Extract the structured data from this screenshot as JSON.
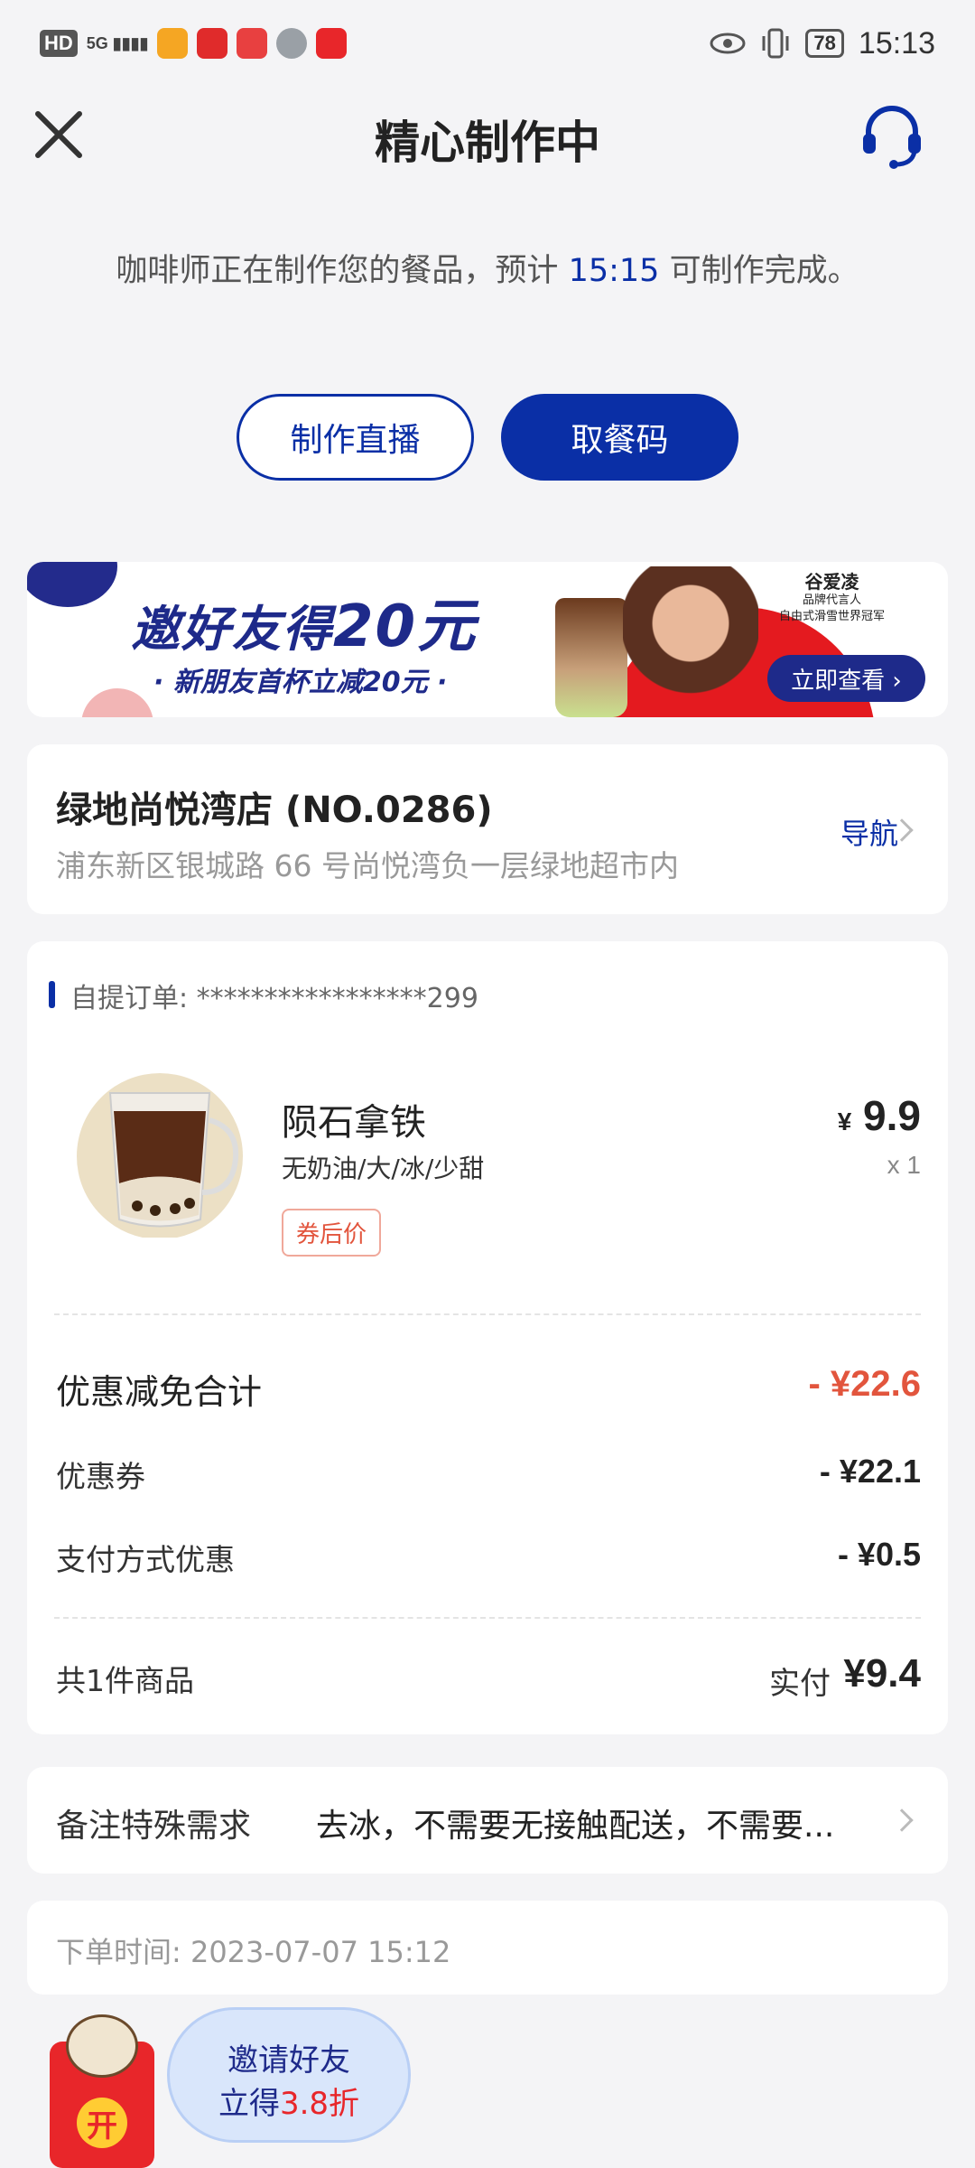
{
  "status_bar": {
    "hd": "HD",
    "signal": "5G",
    "battery": "78",
    "time": "15:13"
  },
  "nav": {
    "title": "精心制作中"
  },
  "progress": {
    "text_before": "咖啡师正在制作您的餐品，预计 ",
    "eta": "15:15",
    "text_after": " 可制作完成。"
  },
  "actions": {
    "live_label": "制作直播",
    "pickup_code_label": "取餐码"
  },
  "banner": {
    "title_prefix": "邀好友得",
    "title_amount": "20元",
    "subtitle": "· 新朋友首杯立减20元 ·",
    "brand_name": "谷爱凌",
    "brand_line1": "品牌代言人",
    "brand_line2": "自由式滑雪世界冠军",
    "cta": "立即查看 ›"
  },
  "store": {
    "name": "绿地尚悦湾店 (NO.0286)",
    "address": "浦东新区银城路 66 号尚悦湾负一层绿地超市内",
    "nav_label": "导航"
  },
  "order": {
    "id_label": "自提订单: *****************299",
    "product": {
      "name": "陨石拿铁",
      "spec": "无奶油/大/冰/少甜",
      "tag": "券后价",
      "price_symbol": "¥",
      "price": "9.9",
      "qty": "x 1"
    },
    "discount_total_label": "优惠减免合计",
    "discount_total_value": "- ¥22.6",
    "coupon_label": "优惠券",
    "coupon_value": "- ¥22.1",
    "payment_discount_label": "支付方式优惠",
    "payment_discount_value": "- ¥0.5",
    "item_count": "共1件商品",
    "paid_label": "实付",
    "paid_value": "¥9.4"
  },
  "remarks": {
    "label": "备注特殊需求",
    "value": "去冰，不需要无接触配送，不需要..."
  },
  "order_time": {
    "text": "下单时间:  2023-07-07 15:12"
  },
  "invite": {
    "line1": "邀请好友",
    "line2_prefix": "立得",
    "line2_highlight": "3.8折",
    "coin": "开"
  },
  "colors": {
    "brand_blue": "#0a2fa6",
    "discount_red": "#e2553d"
  }
}
